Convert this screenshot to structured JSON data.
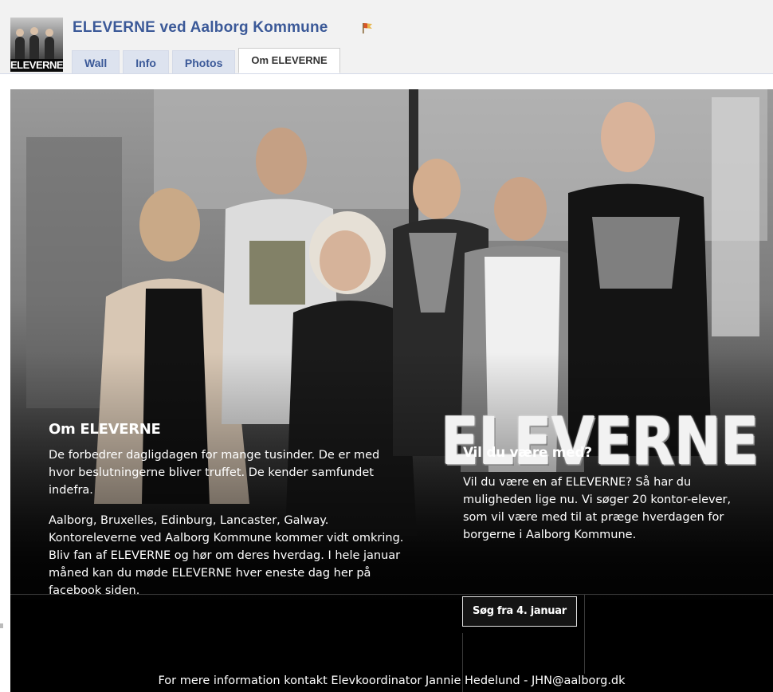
{
  "header": {
    "page_title": "ELEVERNE ved Aalborg Kommune",
    "profile_logo_text": "ELEVERNE",
    "tabs": [
      {
        "label": "Wall",
        "active": false
      },
      {
        "label": "Info",
        "active": false
      },
      {
        "label": "Photos",
        "active": false
      },
      {
        "label": "Om ELEVERNE",
        "active": true
      }
    ]
  },
  "banner": {
    "logo_text": "ELEVERNE",
    "about": {
      "title": "Om ELEVERNE",
      "paragraph1": "De forbedrer dagligdagen for mange tusinder. De er med hvor beslutningerne bliver truffet. De kender samfundet indefra.",
      "paragraph2": "Aalborg, Bruxelles, Edinburg, Lancaster, Galway. Kontoreleverne ved Aalborg Kommune kommer vidt omkring. Bliv fan af ELEVERNE og hør om deres hverdag. I hele januar måned kan du møde ELEVERNE hver eneste dag her på facebook siden."
    },
    "join": {
      "title": "Vil du være med?",
      "text": "Vil du være en af ELEVERNE? Så har du muligheden lige nu. Vi søger 20 kontor-elever, som vil være med til at præge hverdagen for borgerne  i Aalborg Kommune.",
      "button_label": "Søg fra 4. januar"
    },
    "footer": "For mere information kontakt Elevkoordinator Jannie Hedelund - JHN@aalborg.dk"
  },
  "colors": {
    "fb_blue": "#3b5998",
    "tab_bg": "#dde3ef",
    "banner_bg": "#000000",
    "text_white": "#ffffff"
  },
  "icons": {
    "flag": "flag-icon"
  }
}
